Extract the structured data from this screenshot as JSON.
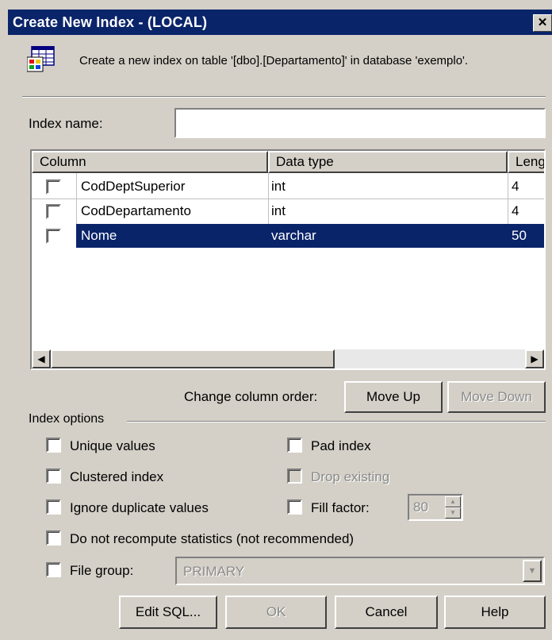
{
  "window": {
    "title": "Create New Index - (LOCAL)",
    "close_glyph": "✕"
  },
  "description": "Create a new index on table '[dbo].[Departamento]' in database 'exemplo'.",
  "index_name": {
    "label": "Index name:",
    "value": ""
  },
  "columns_table": {
    "headers": [
      "Column",
      "Data type",
      "Leng"
    ],
    "rows": [
      {
        "checked": false,
        "column": "CodDeptSuperior",
        "type": "int",
        "length": "4",
        "selected": false
      },
      {
        "checked": false,
        "column": "CodDepartamento",
        "type": "int",
        "length": "4",
        "selected": false
      },
      {
        "checked": false,
        "column": "Nome",
        "type": "varchar",
        "length": "50",
        "selected": true
      }
    ]
  },
  "column_order": {
    "label": "Change column order:",
    "move_up": "Move Up",
    "move_down": "Move Down"
  },
  "index_options": {
    "group_label": "Index options",
    "unique_values": "Unique values",
    "clustered_index": "Clustered index",
    "ignore_duplicate_values": "Ignore duplicate values",
    "pad_index": "Pad index",
    "drop_existing": "Drop existing",
    "fill_factor": "Fill factor:",
    "fill_factor_value": "80",
    "no_recompute": "Do not recompute statistics (not recommended)",
    "file_group": "File group:",
    "file_group_value": "PRIMARY"
  },
  "buttons": {
    "edit_sql": "Edit SQL...",
    "ok": "OK",
    "cancel": "Cancel",
    "help": "Help"
  },
  "colors": {
    "title_bar": "#0a246a",
    "face": "#d4d0c8",
    "selection": "#0a246a"
  }
}
